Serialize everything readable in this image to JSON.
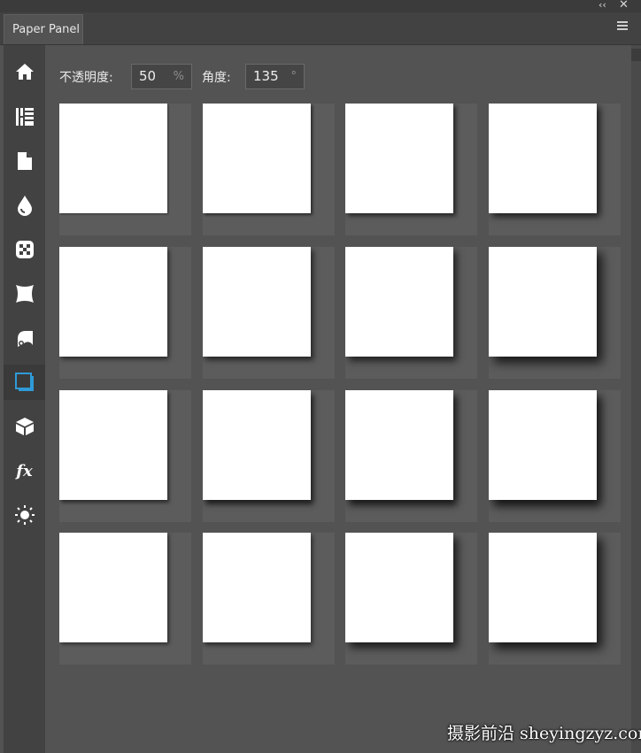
{
  "window": {
    "collapse_glyph": "‹‹",
    "close_glyph": "✕"
  },
  "panel": {
    "tab_label": "Paper Panel"
  },
  "toolbar": [
    {
      "icon": "home-icon"
    },
    {
      "icon": "texture-grid-icon"
    },
    {
      "icon": "document-icon"
    },
    {
      "icon": "drop-icon"
    },
    {
      "icon": "pattern-icon"
    },
    {
      "icon": "warp-icon"
    },
    {
      "icon": "curl-icon"
    },
    {
      "icon": "shadow-square-icon",
      "active": true
    },
    {
      "icon": "cube-icon"
    },
    {
      "icon": "fx-icon",
      "glyph": "fx"
    },
    {
      "icon": "sun-icon"
    }
  ],
  "controls": {
    "opacity_label": "不透明度:",
    "opacity_value": "50",
    "opacity_unit": "%",
    "angle_label": "角度:",
    "angle_value": "135",
    "angle_unit": "°"
  },
  "colors": {
    "accent": "#2f9ad8",
    "panel_bg": "#535353",
    "toolbar_bg": "#424242"
  },
  "watermark": "摄影前沿 sheyingzyz.com"
}
